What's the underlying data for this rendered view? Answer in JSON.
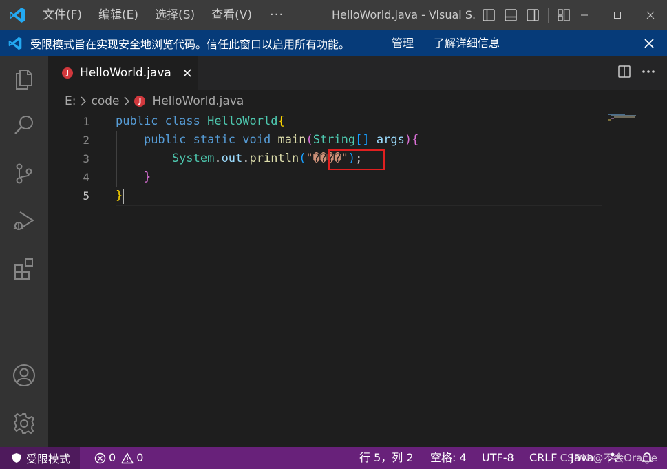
{
  "titlebar": {
    "menu": [
      "文件(F)",
      "编辑(E)",
      "选择(S)",
      "查看(V)"
    ],
    "more": "···",
    "title": "HelloWorld.java - Visual S..."
  },
  "banner": {
    "message": "受限模式旨在实现安全地浏览代码。信任此窗口以启用所有功能。",
    "manage": "管理",
    "learn_more": "了解详细信息"
  },
  "tab": {
    "label": "HelloWorld.java",
    "icon_letter": "J"
  },
  "breadcrumb": {
    "drive": "E:",
    "folder": "code",
    "file": "HelloWorld.java"
  },
  "editor": {
    "line_numbers": [
      "1",
      "2",
      "3",
      "4",
      "5"
    ],
    "line1": {
      "kw1": "public",
      "kw2": "class",
      "cls": "HelloWorld",
      "brace": "{"
    },
    "line2": {
      "kw1": "public",
      "kw2": "static",
      "kw3": "void",
      "fn": "main",
      "paren_open": "(",
      "type": "String",
      "arr": "[]",
      "arg": "args",
      "paren_close": ")",
      "brace": "{"
    },
    "line3": {
      "obj": "System",
      "dot1": ".",
      "field": "out",
      "dot2": ".",
      "fn": "println",
      "paren_open": "(",
      "quote1": "\"",
      "garbled": "����",
      "quote2": "\"",
      "paren_close": ")",
      "semi": ";"
    },
    "line4": {
      "brace": "}"
    },
    "line5": {
      "brace": "}"
    }
  },
  "statusbar": {
    "restricted": "受限模式",
    "errors": "0",
    "warnings": "0",
    "position": "行 5，列 2",
    "spaces": "空格: 4",
    "encoding": "UTF-8",
    "eol": "CRLF",
    "language": "Java",
    "watermark": "CSDN @不会Oracle"
  },
  "colors": {
    "accent": "#0078d4",
    "statusbar": "#68217a",
    "banner": "#063b79",
    "highlight": "#e02020"
  }
}
